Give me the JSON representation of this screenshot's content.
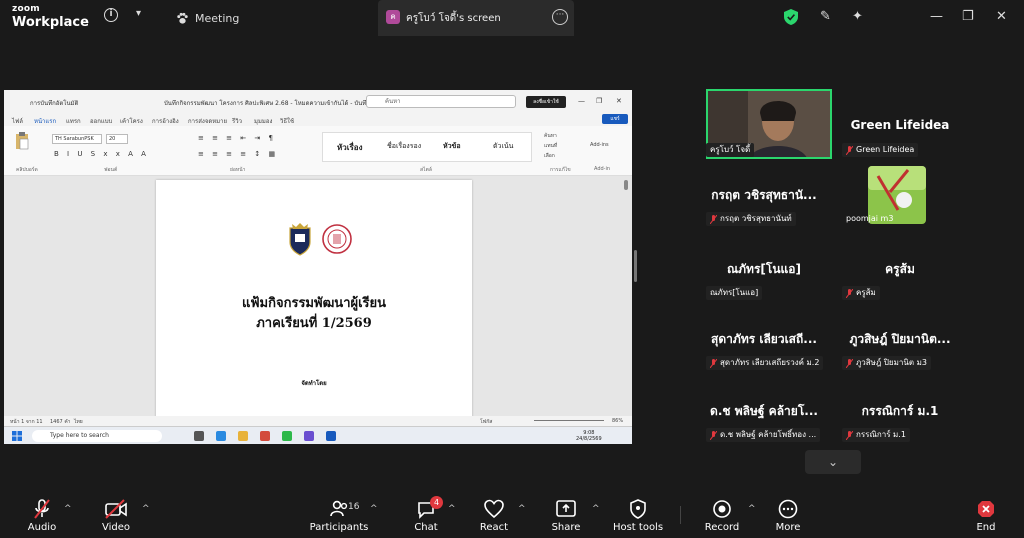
{
  "app": {
    "logo_line1": "zoom",
    "logo_line2": "Workplace"
  },
  "top": {
    "meeting_label": "Meeting",
    "share_avatar": "ค",
    "share_label": "ครูโบว์ โจดี้'s screen"
  },
  "shared_screen": {
    "window_title": "บันทึกกิจกรรมพัฒนา โครงการ ศิลปะพิเศษ 2.68 - โหมดความเข้ากันได้ - บันทึกแล้ว",
    "autosave": "การบันทึกอัตโนมัติ",
    "search_placeholder": "ค้นหา",
    "dark_btn": "ลงชื่อเข้าใช้",
    "tabs": [
      "ไฟล์",
      "หน้าแรก",
      "แทรก",
      "ออกแบบ",
      "เค้าโครง",
      "การอ้างอิง",
      "การส่งจดหมาย",
      "รีวิว",
      "มุมมอง",
      "วิธีใช้"
    ],
    "share_btn": "แชร์",
    "font_name": "TH SarabunPSK",
    "font_size": "20",
    "styles": [
      "หัวเรื่อง",
      "ชื่อเรื่องรอง",
      "หัวข้อ",
      "ตัวเน้น"
    ],
    "ribbon_labels": [
      "คลิปบอร์ด",
      "ฟอนต์",
      "ย่อหน้า",
      "สไตล์",
      "การแก้ไข",
      "Add-in"
    ],
    "ribbon_small": [
      "ค้นหา",
      "แทนที่",
      "เลือก",
      "Add-ins"
    ],
    "doc_line1": "แฟ้มกิจกรรมพัฒนาผู้เรียน",
    "doc_line2": "ภาคเรียนที่ 1/2569",
    "doc_line3": "จัดทำโดย",
    "status_left": "หน้า 1 จาก 11",
    "status_words": "1467 คำ",
    "status_lang": "ไทย",
    "status_focus": "โฟกัส",
    "zoom_pct": "86%",
    "taskbar_search": "Type here to search",
    "clock_time": "9:08",
    "clock_date": "24/8/2569"
  },
  "gallery": [
    {
      "big": "",
      "tag": "ครูโบว์ โจดี้",
      "muted": false,
      "video": true
    },
    {
      "big": "Green Lifeidea",
      "tag": "Green Lifeidea",
      "muted": true
    },
    {
      "big": "กรฤต วชิรสุทธานั...",
      "tag": "กรฤต วชิรสุทธานันท์",
      "muted": true
    },
    {
      "big": "",
      "tag": "poomjai m3",
      "muted": false,
      "avatar": true
    },
    {
      "big": "ณภัทร[โนแอ]",
      "tag": "ณภัทร[โนแอ]",
      "muted": false
    },
    {
      "big": "ครูส้ม",
      "tag": "ครูส้ม",
      "muted": true
    },
    {
      "big": "สุดาภัทร เลียวเสถี...",
      "tag": "สุดาภัทร เลียวเสถียรวงค์ ม.2",
      "muted": true
    },
    {
      "big": "ภูวสิษฎ์ ปิยมานิต...",
      "tag": "ภูวสิษฎ์ ปิยมานิต ม3",
      "muted": true
    },
    {
      "big": "ด.ช พลิษฐ์ คล้ายโ...",
      "tag": "ด.ช พลิษฐ์ คล้ายโพธิ์ทอง ...",
      "muted": true
    },
    {
      "big": "กรรณิการ์ ม.1",
      "tag": "กรรณิการ์ ม.1",
      "muted": true
    }
  ],
  "toolbar": {
    "audio": "Audio",
    "video": "Video",
    "participants": "Participants",
    "participants_count": "16",
    "chat": "Chat",
    "chat_badge": "4",
    "react": "React",
    "share": "Share",
    "host_tools": "Host tools",
    "record": "Record",
    "more": "More",
    "end": "End"
  },
  "colors": {
    "active_speaker": "#2bd66d",
    "muted": "#e0383e",
    "end": "#e0383e",
    "shield": "#2bd66d"
  }
}
